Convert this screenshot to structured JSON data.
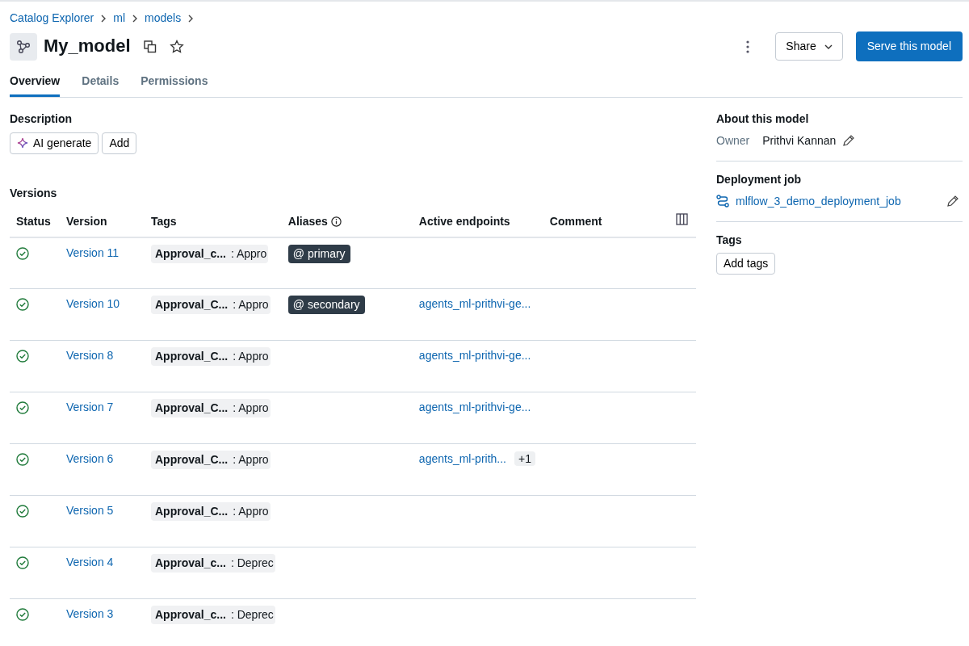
{
  "breadcrumb": [
    "Catalog Explorer",
    "ml",
    "models"
  ],
  "title": "My_model",
  "actions": {
    "share": "Share",
    "serve": "Serve this model"
  },
  "tabs": [
    {
      "label": "Overview",
      "selected": true
    },
    {
      "label": "Details",
      "selected": false
    },
    {
      "label": "Permissions",
      "selected": false
    }
  ],
  "description": {
    "heading": "Description",
    "buttons": [
      "AI generate",
      "Add"
    ]
  },
  "versions": {
    "heading": "Versions",
    "columns": [
      "Status",
      "Version",
      "Tags",
      "Aliases",
      "Active endpoints",
      "Comment"
    ],
    "rows": [
      {
        "succeeded": true,
        "version": "Version 11",
        "tag_key": "Approval_c...",
        "tag_value": ": Appro",
        "alias": "@ primary",
        "endpoint": null,
        "extra": null
      },
      {
        "succeeded": true,
        "version": "Version 10",
        "tag_key": "Approval_C...",
        "tag_value": ": Appro",
        "alias": "@ secondary",
        "endpoint": "agents_ml-prithvi-ge...",
        "extra": null
      },
      {
        "succeeded": true,
        "version": "Version 8",
        "tag_key": "Approval_C...",
        "tag_value": ": Appro",
        "alias": null,
        "endpoint": "agents_ml-prithvi-ge...",
        "extra": null
      },
      {
        "succeeded": true,
        "version": "Version 7",
        "tag_key": "Approval_C...",
        "tag_value": ": Appro",
        "alias": null,
        "endpoint": "agents_ml-prithvi-ge...",
        "extra": null
      },
      {
        "succeeded": true,
        "version": "Version 6",
        "tag_key": "Approval_C...",
        "tag_value": ": Appro",
        "alias": null,
        "endpoint": "agents_ml-prith...",
        "extra": "+1"
      },
      {
        "succeeded": true,
        "version": "Version 5",
        "tag_key": "Approval_C...",
        "tag_value": ": Appro",
        "alias": null,
        "endpoint": null,
        "extra": null
      },
      {
        "succeeded": true,
        "version": "Version 4",
        "tag_key": "Approval_c...",
        "tag_value": ": Deprec",
        "alias": null,
        "endpoint": null,
        "extra": null
      },
      {
        "succeeded": true,
        "version": "Version 3",
        "tag_key": "Approval_c...",
        "tag_value": ": Deprec",
        "alias": null,
        "endpoint": null,
        "extra": null
      }
    ]
  },
  "about": {
    "heading": "About this model",
    "owner_label": "Owner",
    "owner": "Prithvi Kannan"
  },
  "deployment": {
    "heading": "Deployment job",
    "job": "mlflow_3_demo_deployment_job"
  },
  "tags": {
    "heading": "Tags",
    "button": "Add tags"
  }
}
